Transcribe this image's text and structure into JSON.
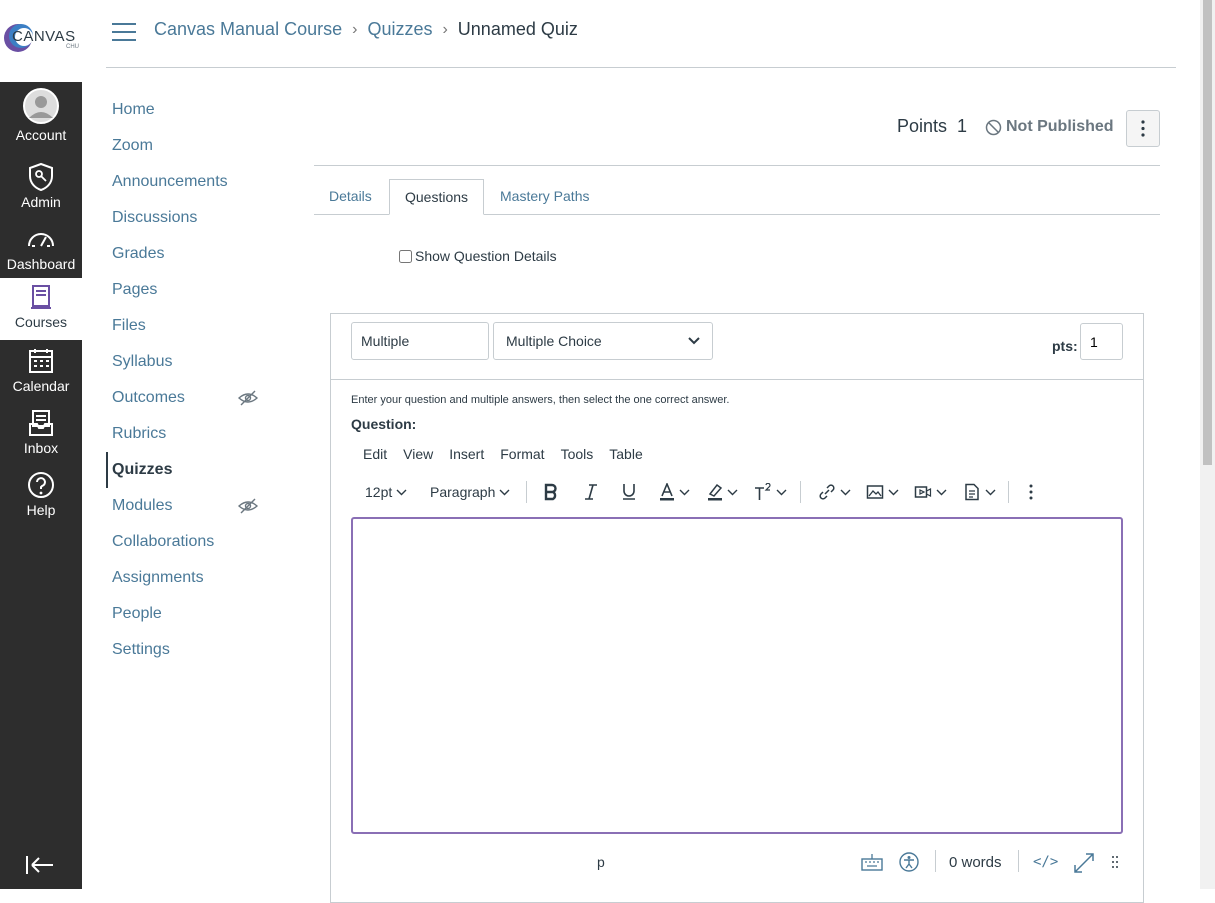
{
  "brand": {
    "logo_text": "CANVAS",
    "logo_sub": "CHU",
    "accent": "#4a7998",
    "nav_bg": "#2d2d2d",
    "focus": "#8a6fb5"
  },
  "global_nav": [
    {
      "label": "Account",
      "icon": "avatar-icon"
    },
    {
      "label": "Admin",
      "icon": "shield-icon"
    },
    {
      "label": "Dashboard",
      "icon": "dashboard-icon"
    },
    {
      "label": "Courses",
      "icon": "book-icon",
      "active": true
    },
    {
      "label": "Calendar",
      "icon": "calendar-icon"
    },
    {
      "label": "Inbox",
      "icon": "inbox-icon"
    },
    {
      "label": "Help",
      "icon": "help-icon"
    }
  ],
  "breadcrumb": {
    "course": "Canvas Manual Course",
    "section": "Quizzes",
    "current": "Unnamed Quiz",
    "separator": "›"
  },
  "course_nav": [
    {
      "label": "Home"
    },
    {
      "label": "Zoom"
    },
    {
      "label": "Announcements"
    },
    {
      "label": "Discussions"
    },
    {
      "label": "Grades"
    },
    {
      "label": "Pages"
    },
    {
      "label": "Files"
    },
    {
      "label": "Syllabus"
    },
    {
      "label": "Outcomes",
      "hidden": true
    },
    {
      "label": "Rubrics"
    },
    {
      "label": "Quizzes",
      "active": true
    },
    {
      "label": "Modules",
      "hidden": true
    },
    {
      "label": "Collaborations"
    },
    {
      "label": "Assignments"
    },
    {
      "label": "People"
    },
    {
      "label": "Settings"
    }
  ],
  "quiz_header": {
    "points_label": "Points",
    "points_value": "1",
    "status": "Not Published"
  },
  "tabs": [
    {
      "label": "Details"
    },
    {
      "label": "Questions",
      "active": true
    },
    {
      "label": "Mastery Paths"
    }
  ],
  "show_details": {
    "label": "Show Question Details",
    "checked": false
  },
  "question": {
    "name": "Multiple",
    "type": "Multiple Choice",
    "pts_label": "pts:",
    "pts_value": "1",
    "instructions": "Enter your question and multiple answers, then select the one correct answer.",
    "label": "Question:"
  },
  "editor": {
    "menu": [
      "Edit",
      "View",
      "Insert",
      "Format",
      "Tools",
      "Table"
    ],
    "font_size": "12pt",
    "block": "Paragraph",
    "status_path": "p",
    "word_count": "0 words",
    "html_toggle": "</>"
  }
}
